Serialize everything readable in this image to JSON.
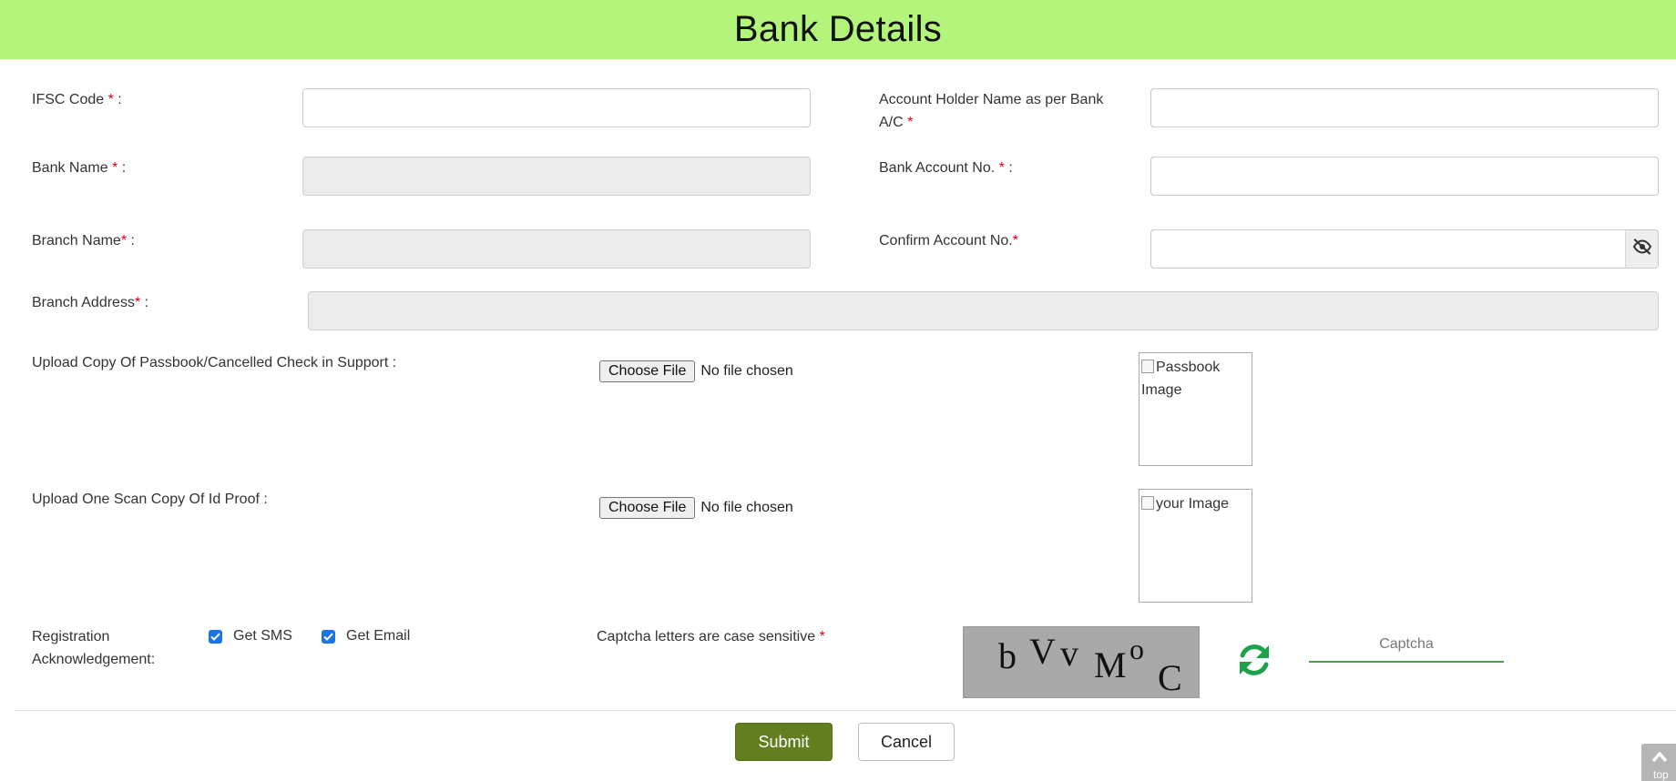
{
  "header": {
    "title": "Bank Details"
  },
  "form": {
    "ifsc": {
      "label": "IFSC Code ",
      "required": "*",
      "suffix": " :",
      "value": ""
    },
    "account_holder": {
      "label": "Account Holder Name as per Bank A/C ",
      "required": "*",
      "value": ""
    },
    "bank_name": {
      "label": "Bank Name ",
      "required": "*",
      "suffix": " :",
      "value": ""
    },
    "bank_account_no": {
      "label": "Bank Account No. ",
      "required": "*",
      "suffix": " :",
      "value": ""
    },
    "branch_name": {
      "label": "Branch Name",
      "required": "*",
      "suffix": " :",
      "value": ""
    },
    "confirm_account_no": {
      "label": "Confirm Account No.",
      "required": "*",
      "value": "",
      "toggle_icon": "eye-slash-icon"
    },
    "branch_address": {
      "label": "Branch Address",
      "required": "*",
      "suffix": " :",
      "value": ""
    },
    "passbook_upload": {
      "label": "Upload Copy Of Passbook/Cancelled Check in Support :",
      "button_label": "Choose File",
      "status": "No file chosen",
      "image_alt": "Passbook Image"
    },
    "id_proof_upload": {
      "label": "Upload One Scan Copy Of Id Proof :",
      "button_label": "Choose File",
      "status": "No file chosen",
      "image_alt": "your Image"
    },
    "registration_ack": {
      "label_line1": "Registration",
      "label_line2": "Acknowledgement:",
      "options": [
        {
          "label": "Get SMS",
          "checked": true
        },
        {
          "label": "Get Email",
          "checked": true
        }
      ]
    },
    "captcha": {
      "label": "Captcha letters are case sensitive ",
      "required": "*",
      "image_text": [
        "b",
        "V",
        "v",
        "M",
        "o",
        "C"
      ],
      "input_placeholder": "Captcha",
      "refresh_icon": "refresh-icon"
    }
  },
  "actions": {
    "submit_label": "Submit",
    "cancel_label": "Cancel"
  },
  "scroll_top": {
    "icon": "chevron-up-icon",
    "label": "top"
  },
  "colors": {
    "header_bg": "#b3f57b",
    "required": "#e0001a",
    "submit_bg": "#627e1e",
    "checkbox": "#1a73e8",
    "refresh": "#1aa34a",
    "captcha_underline": "#43a047"
  }
}
